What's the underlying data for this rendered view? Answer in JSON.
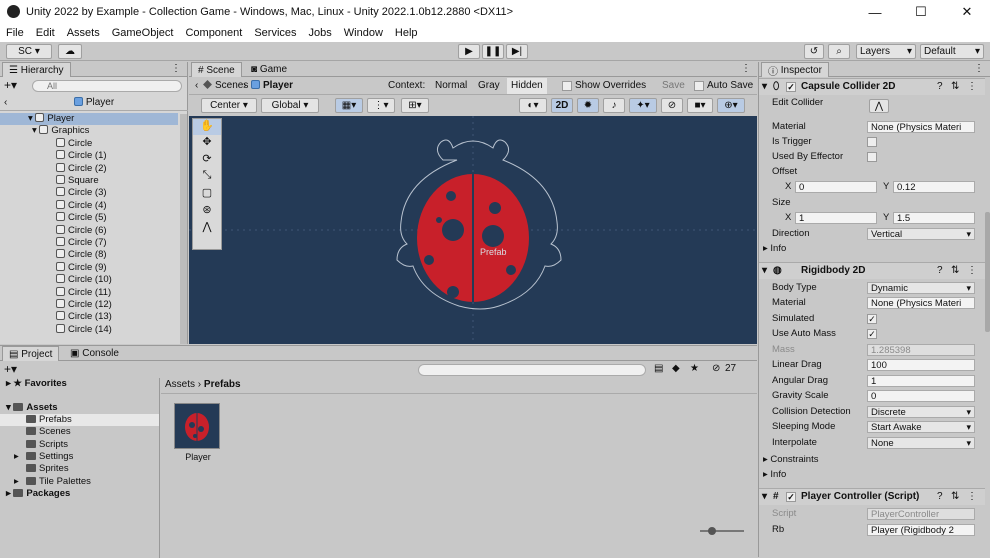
{
  "window": {
    "title": "Unity 2022 by Example - Collection Game - Windows, Mac, Linux - Unity 2022.1.0b12.2880 <DX11>",
    "minimize": "—",
    "maximize": "☐",
    "close": "✕"
  },
  "menu": [
    "File",
    "Edit",
    "Assets",
    "GameObject",
    "Component",
    "Services",
    "Jobs",
    "Window",
    "Help"
  ],
  "toolbar": {
    "account": "SC",
    "layers": "Layers",
    "layout": "Default",
    "play": "▶",
    "pause": "❚❚",
    "step": "▶|"
  },
  "hierarchy": {
    "tab": "Hierarchy",
    "search_placeholder": "All",
    "prefab_title": "Player",
    "items": [
      {
        "label": "Player",
        "indent": 0
      },
      {
        "label": "Graphics",
        "indent": 1
      },
      {
        "label": "Circle",
        "indent": 2
      },
      {
        "label": "Circle (1)",
        "indent": 2
      },
      {
        "label": "Circle (2)",
        "indent": 2
      },
      {
        "label": "Square",
        "indent": 2
      },
      {
        "label": "Circle (3)",
        "indent": 2
      },
      {
        "label": "Circle (4)",
        "indent": 2
      },
      {
        "label": "Circle (5)",
        "indent": 2
      },
      {
        "label": "Circle (6)",
        "indent": 2
      },
      {
        "label": "Circle (7)",
        "indent": 2
      },
      {
        "label": "Circle (8)",
        "indent": 2
      },
      {
        "label": "Circle (9)",
        "indent": 2
      },
      {
        "label": "Circle (10)",
        "indent": 2
      },
      {
        "label": "Circle (11)",
        "indent": 2
      },
      {
        "label": "Circle (12)",
        "indent": 2
      },
      {
        "label": "Circle (13)",
        "indent": 2
      },
      {
        "label": "Circle (14)",
        "indent": 2
      }
    ]
  },
  "scene": {
    "tabs": [
      "Scene",
      "Game"
    ],
    "breadcrumb": [
      "Scenes",
      "Player"
    ],
    "context_label": "Context:",
    "modes": [
      "Normal",
      "Gray",
      "Hidden"
    ],
    "show_overrides": "Show Overrides",
    "save": "Save",
    "auto_save": "Auto Save",
    "pivot": "Center",
    "space": "Global",
    "toggle_2d": "2D",
    "prefab_label": "Prefab"
  },
  "project": {
    "tabs": [
      "Project",
      "Console"
    ],
    "favorites": "Favorites",
    "assets": "Assets",
    "folders": [
      "Prefabs",
      "Scenes",
      "Scripts",
      "Settings",
      "Sprites",
      "Tile Palettes"
    ],
    "packages": "Packages",
    "breadcrumb": [
      "Assets",
      "Prefabs"
    ],
    "asset_name": "Player",
    "count": "27"
  },
  "inspector": {
    "tab": "Inspector",
    "capsule": {
      "title": "Capsule Collider 2D",
      "edit_collider": "Edit Collider",
      "material": "Material",
      "material_value": "None (Physics Materi",
      "is_trigger": "Is Trigger",
      "used_by_effector": "Used By Effector",
      "offset": "Offset",
      "offset_x": "0",
      "offset_y": "0.12",
      "size": "Size",
      "size_x": "1",
      "size_y": "1.5",
      "direction": "Direction",
      "direction_value": "Vertical",
      "info": "Info"
    },
    "rigidbody": {
      "title": "Rigidbody 2D",
      "body_type": "Body Type",
      "body_type_value": "Dynamic",
      "material": "Material",
      "material_value": "None (Physics Materi",
      "simulated": "Simulated",
      "use_auto_mass": "Use Auto Mass",
      "mass": "Mass",
      "mass_value": "1.285398",
      "linear_drag": "Linear Drag",
      "linear_drag_value": "100",
      "angular_drag": "Angular Drag",
      "angular_drag_value": "1",
      "gravity_scale": "Gravity Scale",
      "gravity_scale_value": "0",
      "collision_detection": "Collision Detection",
      "collision_detection_value": "Discrete",
      "sleeping_mode": "Sleeping Mode",
      "sleeping_mode_value": "Start Awake",
      "interpolate": "Interpolate",
      "interpolate_value": "None",
      "constraints": "Constraints",
      "info": "Info"
    },
    "controller": {
      "title": "Player Controller (Script)",
      "script": "Script",
      "script_value": "PlayerController",
      "rb": "Rb",
      "rb_value": "Player (Rigidbody 2"
    },
    "x": "X",
    "y": "Y",
    "check": "✓"
  },
  "colors": {
    "scene_bg": "#243a56",
    "ladybug_red": "#c8202a",
    "spot": "#243a56",
    "selection": "#9fb7d6"
  }
}
